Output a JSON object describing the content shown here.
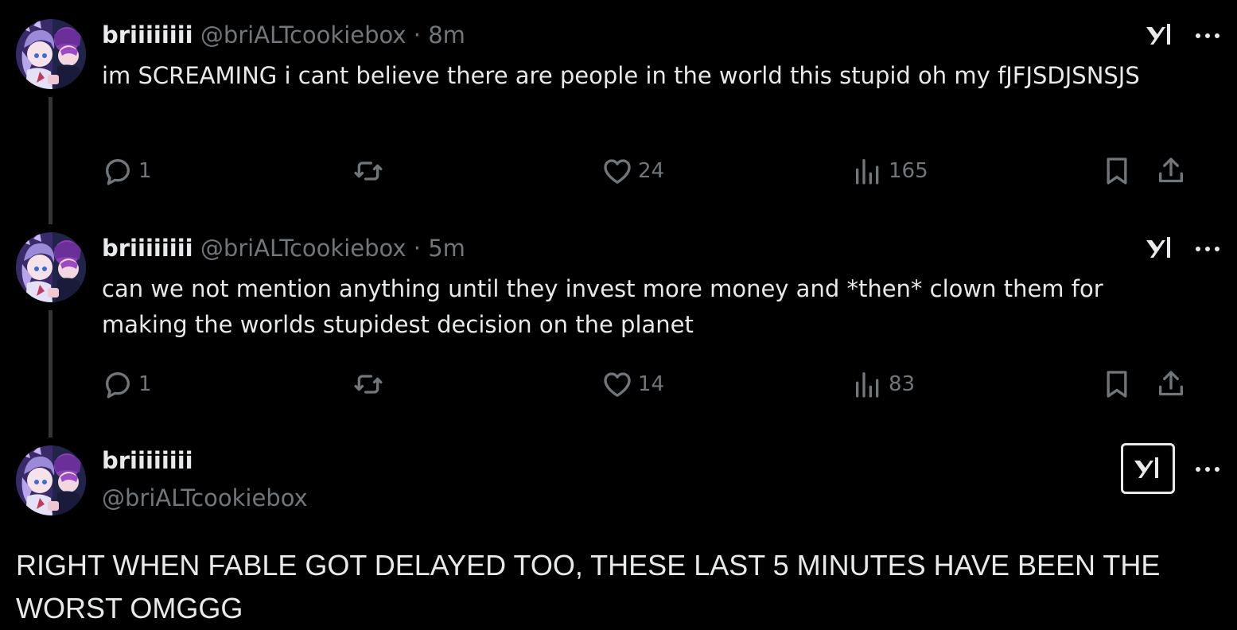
{
  "replies": [
    {
      "name": "briiiiiiii",
      "handle": "@briALTcookiebox",
      "separator": "·",
      "time": "8m",
      "text": "im SCREAMING i cant believe there are people in the world this stupid oh my fJFJSDJSNSJS",
      "reply_count": "1",
      "retweet_count": "",
      "like_count": "24",
      "view_count": "165"
    },
    {
      "name": "briiiiiiii",
      "handle": "@briALTcookiebox",
      "separator": "·",
      "time": "5m",
      "text": "can we not mention anything until they invest more money and *then* clown them for making the worlds stupidest decision on the planet",
      "reply_count": "1",
      "retweet_count": "",
      "like_count": "14",
      "view_count": "83"
    }
  ],
  "main_tweet": {
    "name": "briiiiiiii",
    "handle": "@briALTcookiebox",
    "text": "RIGHT WHEN FABLE GOT DELAYED TOO, THESE LAST 5 MINUTES HAVE BEEN THE WORST OMGGG"
  },
  "icons": {
    "reply": "reply-icon",
    "retweet": "retweet-icon",
    "like": "heart-icon",
    "views": "views-icon",
    "bookmark": "bookmark-icon",
    "share": "share-icon",
    "grok": "grok-icon",
    "more": "more-icon"
  },
  "colors": {
    "background": "#000000",
    "text_primary": "#e7e9ea",
    "text_secondary": "#71767b",
    "thread_line": "#333639"
  }
}
